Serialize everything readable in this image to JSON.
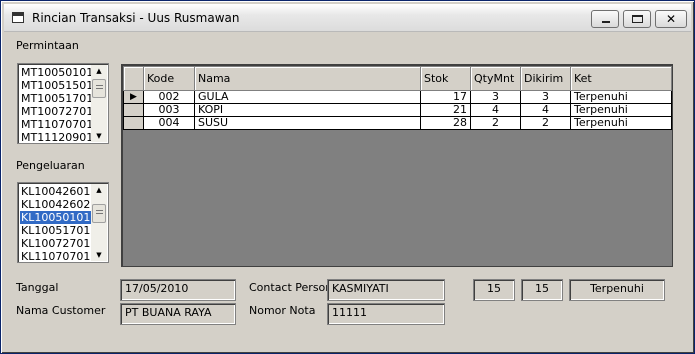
{
  "window": {
    "title": "Rincian Transaksi - Uus Rusmawan",
    "minimize_glyph": "",
    "close_glyph": "✕"
  },
  "permintaan": {
    "label": "Permintaan",
    "items": [
      "MT10050101",
      "MT10051501",
      "MT10051701",
      "MT10072701",
      "MT11070701",
      "MT11120901"
    ]
  },
  "pengeluaran": {
    "label": "Pengeluaran",
    "items": [
      "KL10042601",
      "KL10042602",
      "KL10050101",
      "KL10051701",
      "KL10072701",
      "KL11070701"
    ],
    "selected_index": 2
  },
  "grid": {
    "columns": [
      "Kode",
      "Nama",
      "Stok",
      "QtyMnt",
      "Dikirim",
      "Ket"
    ],
    "current_row_marker": "▶",
    "rows": [
      [
        "002",
        "GULA",
        "17",
        "3",
        "3",
        "Terpenuhi"
      ],
      [
        "003",
        "KOPI",
        "21",
        "4",
        "4",
        "Terpenuhi"
      ],
      [
        "004",
        "SUSU",
        "28",
        "2",
        "2",
        "Terpenuhi"
      ]
    ]
  },
  "form": {
    "tanggal_label": "Tanggal",
    "tanggal_value": "17/05/2010",
    "nama_customer_label": "Nama Customer",
    "nama_customer_value": "PT BUANA RAYA",
    "contact_person_label": "Contact Person",
    "contact_person_value": "KASMIYATI",
    "nomor_nota_label": "Nomor Nota",
    "nomor_nota_value": "11111",
    "qty_value": "15",
    "dikirim_value": "15",
    "ket_value": "Terpenuhi"
  },
  "scrollbar": {
    "up_glyph": "▲",
    "down_glyph": "▼"
  },
  "colors": {
    "face": "#d4d0c8",
    "selection": "#316ac5",
    "window_border": "#0a246a"
  }
}
